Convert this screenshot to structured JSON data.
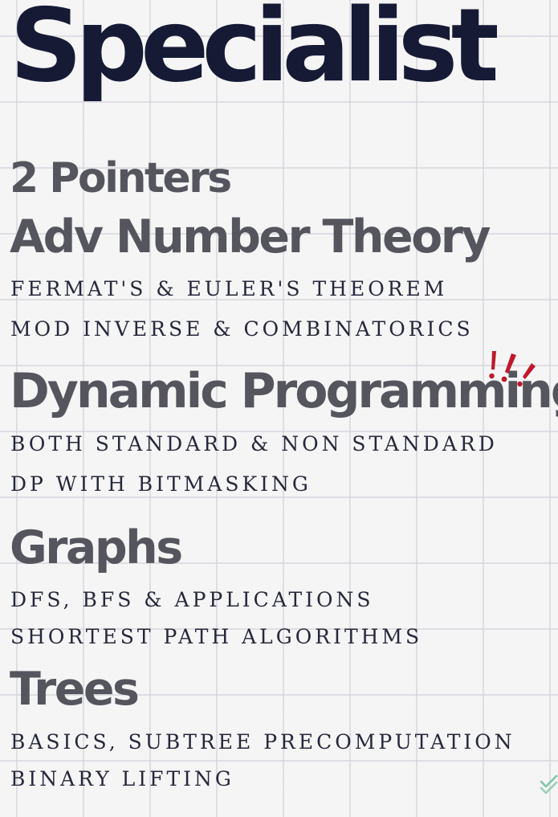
{
  "title": "Specialist",
  "sections": [
    {
      "heading": "2 Pointers",
      "items": []
    },
    {
      "heading": "Adv Number Theory",
      "items": [
        "FERMAT'S & EULER'S THEOREM",
        "MOD INVERSE & COMBINATORICS"
      ]
    },
    {
      "heading": "Dynamic Programming",
      "items": [
        "BOTH STANDARD & NON STANDARD",
        "DP WITH BITMASKING"
      ]
    },
    {
      "heading": "Graphs",
      "items": [
        "DFS, BFS & APPLICATIONS",
        "SHORTEST PATH ALGORITHMS"
      ]
    },
    {
      "heading": "Trees",
      "items": [
        "BASICS, SUBTREE PRECOMPUTATION",
        "BINARY LIFTING"
      ]
    }
  ],
  "decorations": {
    "accent_icon": "exclamation-marks-icon",
    "corner_icon": "check-icon"
  },
  "colors": {
    "background": "#f5f5f6",
    "grid": "#cdcdd4",
    "title": "#161a35",
    "heading": "#55555e",
    "body_text": "#26283a",
    "accent": "#c0182a",
    "check": "#7fc7a3"
  }
}
